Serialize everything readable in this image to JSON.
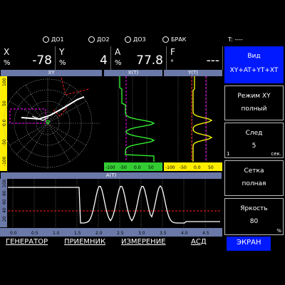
{
  "status": {
    "indicators": [
      "ДО1",
      "ДО2",
      "ДО3",
      "БРАК"
    ],
    "time_label": "T: ----"
  },
  "readouts": [
    {
      "name": "X",
      "unit": "%",
      "value": "-78"
    },
    {
      "name": "Y",
      "unit": "%",
      "value": "4"
    },
    {
      "name": "A",
      "unit": "%",
      "value": "77.8"
    },
    {
      "name": "F",
      "unit": "°",
      "value": "---"
    }
  ],
  "view_panel": {
    "title": "Вид",
    "value": "XY+AT+YT+XT"
  },
  "side_items": [
    {
      "title": "Режим XY",
      "value": "полный"
    },
    {
      "title": "След",
      "value": "5",
      "left_note": "1",
      "right_note": "сек."
    },
    {
      "title": "Сетка",
      "value": "полная"
    },
    {
      "title": "Яркость",
      "value": "80",
      "right_note": "%"
    }
  ],
  "plots": {
    "xy": {
      "title": "XY",
      "axis_ticks": [
        "100",
        "50",
        "0.0",
        "-50",
        "-100"
      ]
    },
    "xt": {
      "title": "X(T)",
      "x_ticks": [
        "-100",
        "-50",
        "0.0",
        "50"
      ]
    },
    "yt": {
      "title": "Y(T)",
      "x_ticks": [
        "-100",
        "-50",
        "0.0",
        "50"
      ]
    },
    "at": {
      "title": "A(T)",
      "x_ticks": [
        "0.0",
        "0.5",
        "1.0",
        "1.5",
        "2.0",
        "2.5",
        "3.0",
        "3.5",
        "4.0",
        "4.5"
      ],
      "y_ticks": [
        "100",
        "80",
        "60",
        "40",
        "20",
        "0"
      ]
    }
  },
  "menu": [
    {
      "label": "ГЕНЕРАТОР",
      "active": false
    },
    {
      "label": "ПРИЕМНИК",
      "active": false
    },
    {
      "label": "ИЗМЕРЕНИЕ",
      "active": false
    },
    {
      "label": "АСД",
      "active": false
    },
    {
      "label": "ЭКРАН",
      "active": true
    }
  ],
  "colors": {
    "x_trace": "#33ff33",
    "y_trace": "#ffff00",
    "a_trace": "#ffffff",
    "threshold": "#ff2020",
    "marker": "#ff00ff",
    "axis_bar_x": "#33cc33",
    "axis_bar_y": "#ffee00",
    "axis_bar_a": "#6b79a8",
    "active_menu": "#0019ff"
  }
}
